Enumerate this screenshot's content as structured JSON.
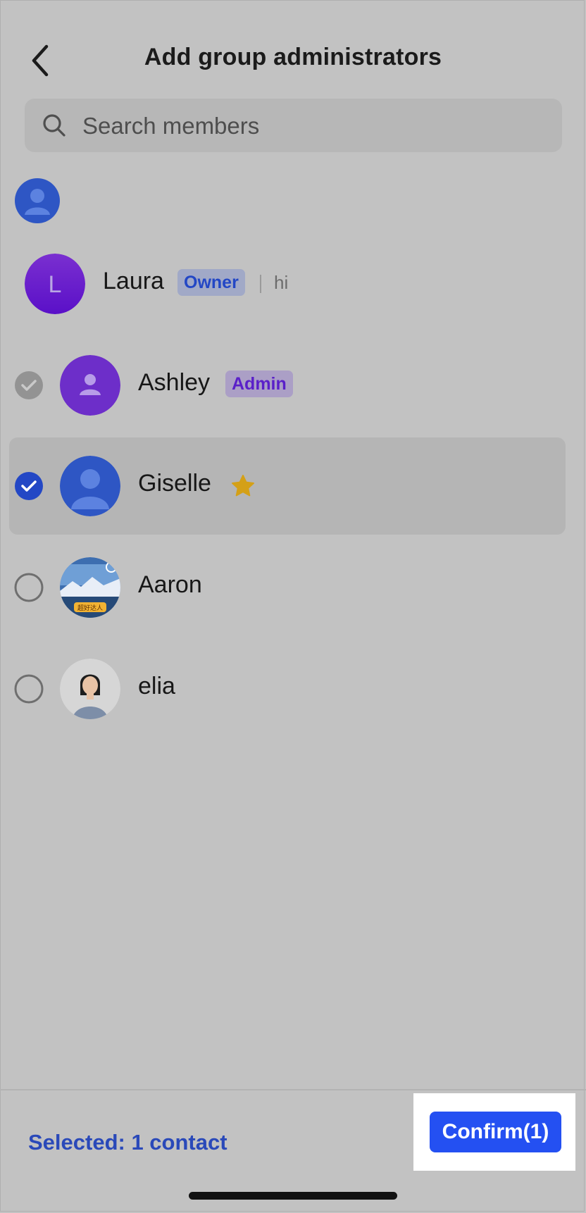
{
  "header": {
    "title": "Add group administrators",
    "back_icon": "chevron-left-icon"
  },
  "search": {
    "placeholder": "Search members",
    "value": "",
    "icon": "search-icon"
  },
  "members": [
    {
      "name": "Laura",
      "initial": "L",
      "badge": "Owner",
      "signature": "hi",
      "selection": "none"
    },
    {
      "name": "Ashley",
      "badge": "Admin",
      "selection": "disabled-checked"
    },
    {
      "name": "Giselle",
      "selection": "checked",
      "star": true
    },
    {
      "name": "Aaron",
      "selection": "unchecked",
      "avatar_caption": "超好达人"
    },
    {
      "name": "elia",
      "selection": "unchecked"
    }
  ],
  "footer": {
    "selected_label": "Selected: 1 contact",
    "confirm_label": "Confirm(1)"
  },
  "colors": {
    "accent": "#2450f2",
    "selected_text": "#2a49b9",
    "owner_badge_text": "#2347c5",
    "admin_badge_text": "#5a1fc9",
    "star": "#d4a017"
  }
}
